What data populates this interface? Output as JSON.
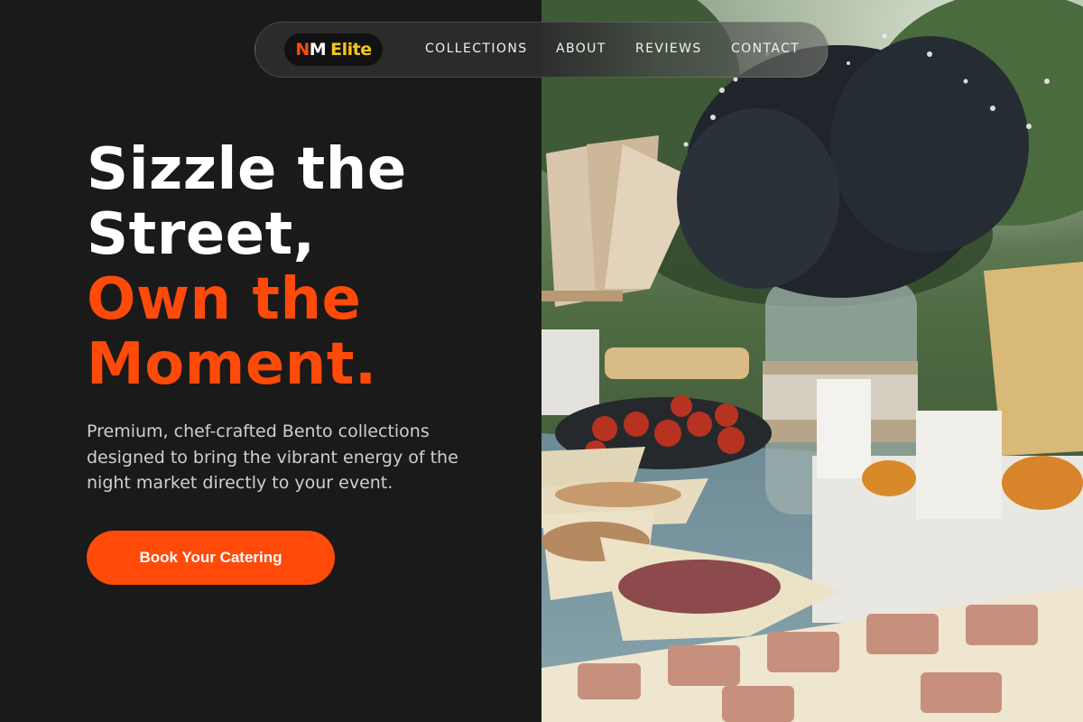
{
  "brand": {
    "logo_part1": "N",
    "logo_part2": "M",
    "logo_part3": "Elite"
  },
  "nav": {
    "items": [
      {
        "label": "COLLECTIONS"
      },
      {
        "label": "ABOUT"
      },
      {
        "label": "REVIEWS"
      },
      {
        "label": "CONTACT"
      }
    ]
  },
  "hero": {
    "headline_line1": "Sizzle the",
    "headline_line2": "Street,",
    "headline_line3": "Own the",
    "headline_line4": "Moment.",
    "subtext": "Premium, chef-crafted Bento collections designed to bring the vibrant energy of the night market directly to your event.",
    "cta_label": "Book Your Catering"
  },
  "colors": {
    "accent": "#ff4a0a",
    "logo_yellow": "#f5c518",
    "background": "#1a1a1a"
  },
  "image": {
    "alt": "outdoor catering table with snacks and flowers"
  }
}
